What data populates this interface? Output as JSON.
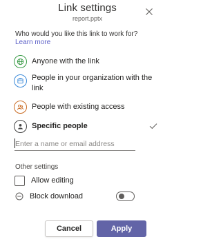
{
  "dialog": {
    "title": "Link settings",
    "file_name": "report.pptx",
    "question": "Who would you like this link to work for?",
    "learn_more": "Learn more"
  },
  "options": [
    {
      "label": "Anyone with the link",
      "icon": "globe-icon",
      "color": "#3a9b47"
    },
    {
      "label": "People in your organization with the link",
      "icon": "organization-icon",
      "color": "#3b8ad9"
    },
    {
      "label": "People with existing access",
      "icon": "people-icon",
      "color": "#ca6c24"
    },
    {
      "label": "Specific people",
      "icon": "person-icon",
      "color": "#444444",
      "selected": true
    }
  ],
  "search": {
    "placeholder": "Enter a name or email address",
    "value": ""
  },
  "other_settings": {
    "heading": "Other settings",
    "allow_editing": {
      "label": "Allow editing",
      "checked": false
    },
    "block_download": {
      "label": "Block download",
      "enabled": false,
      "icon": "block-icon"
    }
  },
  "buttons": {
    "cancel": "Cancel",
    "apply": "Apply"
  },
  "colors": {
    "accent": "#6264a7",
    "link": "#5b5fc7",
    "check": "#605e5c"
  }
}
